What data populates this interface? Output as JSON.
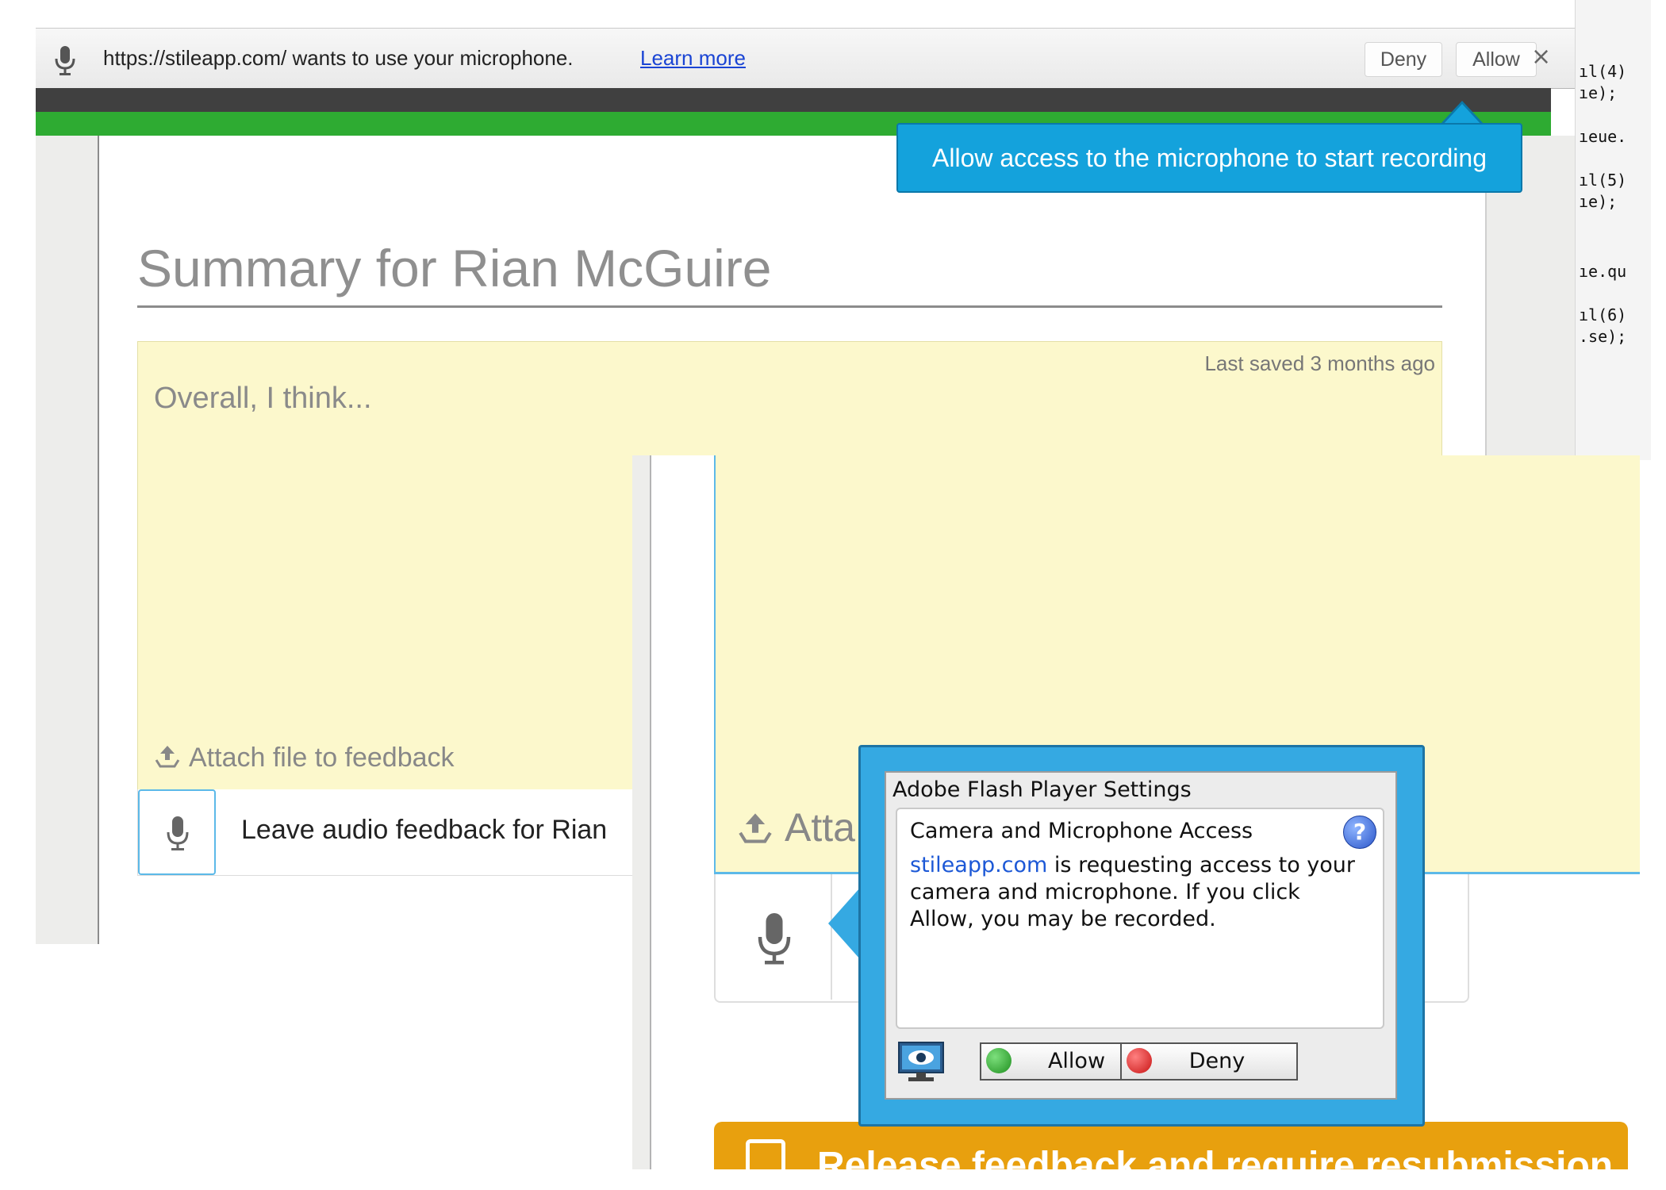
{
  "browser": {
    "permission_bar": {
      "message": "https://stileapp.com/ wants to use your microphone.",
      "learn_more": "Learn more",
      "deny_label": "Deny",
      "allow_label": "Allow",
      "close_glyph": "×"
    },
    "code_lines": [
      "ıl(4)",
      "ıe);",
      "ıeue.",
      "ıl(5)",
      "ıe);",
      "ıe.qu",
      "ıl(6)",
      ".se);"
    ]
  },
  "tooltip": {
    "text": "Allow access to the microphone to start recording"
  },
  "summary": {
    "title": "Summary for Rian McGuire",
    "last_saved": "Last saved 3 months ago",
    "placeholder": "Overall, I think...",
    "attach_label": "Attach file to feedback",
    "audio_label": "Leave audio feedback for Rian"
  },
  "flash_inset": {
    "attach_partial": "Atta",
    "release_partial": "Release feedback and require resubmission",
    "dialog": {
      "title": "Adobe Flash Player Settings",
      "heading": "Camera and Microphone Access",
      "help_glyph": "?",
      "domain": "stileapp.com",
      "body_rest": " is requesting access to your camera and microphone. If you click Allow, you may be recorded.",
      "allow_label": "Allow",
      "deny_label": "Deny"
    }
  },
  "colors": {
    "tooltip_blue": "#14a2dc",
    "green_bar": "#2eab32",
    "note_yellow": "#fcf8cc",
    "flash_frame": "#35a9e2",
    "release_orange": "#e8a00e"
  }
}
